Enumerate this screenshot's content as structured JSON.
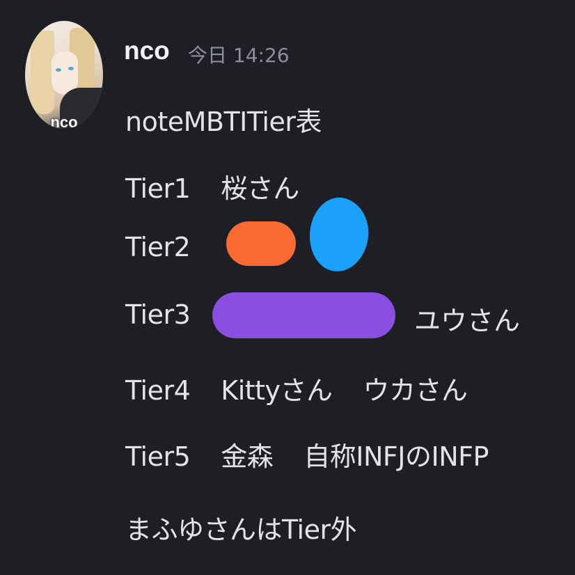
{
  "message": {
    "author": {
      "name": "nco",
      "avatar_label": "nco"
    },
    "timestamp": "今日 14:26",
    "lines": {
      "title": "noteMBTITier表",
      "tier1": {
        "label": "Tier1",
        "members": "桜さん"
      },
      "tier2": {
        "label": "Tier2"
      },
      "tier3": {
        "label": "Tier3",
        "members": "ユウさん"
      },
      "tier4": {
        "label": "Tier4",
        "member1": "Kittyさん",
        "member2": "ウカさん"
      },
      "tier5": {
        "label": "Tier5",
        "member1": "金森",
        "member2": "自称INFJのINFP"
      },
      "footer": "まふゆさんはTier外"
    }
  },
  "redactions": {
    "orange": "#fa6a33",
    "blue": "#1ba1fb",
    "purple": "#8a4fe0"
  },
  "colors": {
    "background": "#1e1f24",
    "text": "#e4e4e7",
    "timestamp": "#8e9097"
  }
}
